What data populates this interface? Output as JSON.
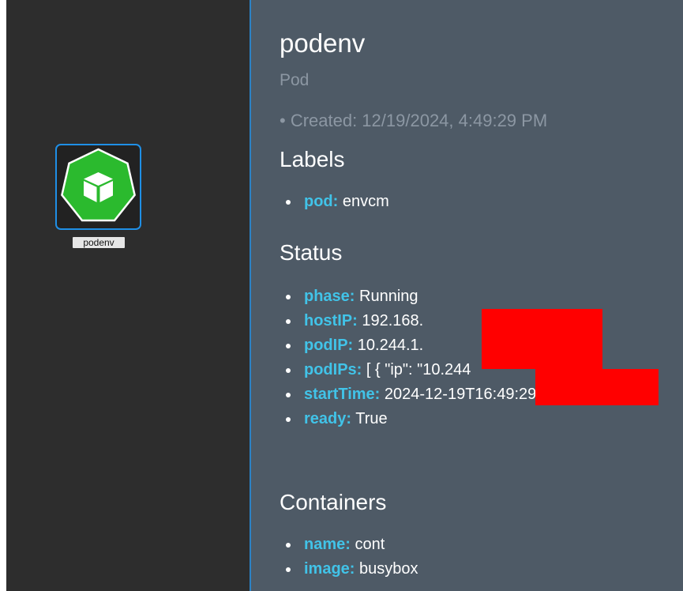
{
  "canvas": {
    "node": {
      "label": "podenv",
      "icon": "kubernetes-pod-icon",
      "colors": {
        "fill": "#2bba2e",
        "border": "#1f8fe6"
      }
    }
  },
  "panel": {
    "title": "podenv",
    "kind": "Pod",
    "created": "• Created: 12/19/2024, 4:49:29 PM",
    "sections": {
      "labels": {
        "heading": "Labels",
        "items": [
          {
            "key": "pod:",
            "value": "envcm"
          }
        ]
      },
      "status": {
        "heading": "Status",
        "items": [
          {
            "key": "phase:",
            "value": "Running"
          },
          {
            "key": "hostIP:",
            "value": "192.168."
          },
          {
            "key": "podIP:",
            "value": "10.244.1."
          },
          {
            "key": "podIPs:",
            "value": "[ { \"ip\": \"10.244"
          },
          {
            "key": "startTime:",
            "value": "2024-12-19T16:49:29Z"
          },
          {
            "key": "ready:",
            "value": "True"
          }
        ]
      },
      "containers": {
        "heading": "Containers",
        "items": [
          {
            "key": "name:",
            "value": "cont"
          },
          {
            "key": "image:",
            "value": "busybox"
          }
        ]
      }
    },
    "colors": {
      "background": "#4e5a66",
      "key": "#41c3e8",
      "muted": "#8c97a3"
    }
  }
}
